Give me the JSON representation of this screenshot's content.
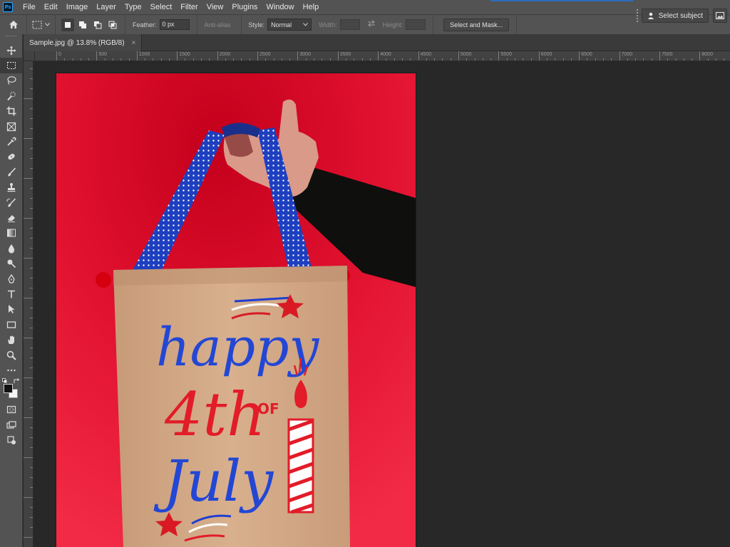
{
  "app": {
    "logo_text": "Ps",
    "menu": [
      "File",
      "Edit",
      "Image",
      "Layer",
      "Type",
      "Select",
      "Filter",
      "View",
      "Plugins",
      "Window",
      "Help"
    ]
  },
  "options_bar": {
    "feather_label": "Feather:",
    "feather_value": "0 px",
    "anti_alias_label": "Anti-alias",
    "style_label": "Style:",
    "style_value": "Normal",
    "width_label": "Width:",
    "height_label": "Height:",
    "select_and_mask_label": "Select and Mask...",
    "select_subject_label": "Select subject"
  },
  "document": {
    "tab_title": "Sample.jpg @ 13.8% (RGB/8)",
    "close_glyph": "×"
  },
  "ruler": {
    "h_ticks": [
      "0",
      "500",
      "1000",
      "1500",
      "2000",
      "2500",
      "3000",
      "3500",
      "4000",
      "4500",
      "5000",
      "5500",
      "6000",
      "6500",
      "7000",
      "7500",
      "8000"
    ]
  },
  "toolbar": {
    "tools": [
      "move",
      "rectangular-marquee",
      "lasso",
      "quick-selection",
      "crop",
      "frame",
      "eyedropper",
      "spot-healing",
      "brush",
      "clone-stamp",
      "history-brush",
      "eraser",
      "gradient",
      "blur",
      "dodge",
      "pen",
      "type",
      "path-selection",
      "rectangle",
      "hand",
      "zoom",
      "more",
      "default-colors",
      "swap-colors",
      "foreground-color",
      "background-color",
      "quick-mask",
      "screen-mode",
      "artboard"
    ],
    "foreground_color": "#121212",
    "background_color": "#f4f4f4"
  },
  "colors": {
    "accent": "#31a8ff",
    "chrome": "#535353",
    "canvas_bg": "#282828"
  }
}
